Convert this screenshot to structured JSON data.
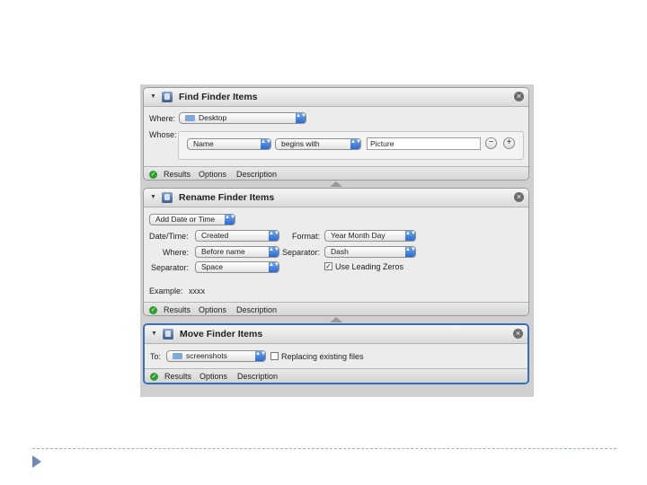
{
  "find": {
    "title": "Find Finder Items",
    "where_label": "Where:",
    "where_value": "Desktop",
    "whose_label": "Whose:",
    "attribute": "Name",
    "operator": "begins with",
    "value": "Picture",
    "remove_symbol": "−",
    "add_symbol": "+"
  },
  "rename": {
    "title": "Rename Finder Items",
    "mode": "Add Date or Time",
    "datetime_label": "Date/Time:",
    "datetime_value": "Created",
    "where_label": "Where:",
    "where_value": "Before name",
    "separator_label": "Separator:",
    "separator_value": "Space",
    "format_label": "Format:",
    "format_value": "Year Month Day",
    "separator2_label": "Separator:",
    "separator2_value": "Dash",
    "leading_zeros_label": "Use Leading Zeros",
    "leading_zeros_checked": true,
    "example_label": "Example:",
    "example_value": "xxxx"
  },
  "move": {
    "title": "Move Finder Items",
    "to_label": "To:",
    "to_value": "screenshots",
    "replace_label": "Replacing existing files",
    "replace_checked": false
  },
  "footer": {
    "results": "Results",
    "options": "Options",
    "description": "Description"
  },
  "icons": {
    "close": "×",
    "check": "✓",
    "disclosure": "▼",
    "popup_arrows": "▲▼"
  },
  "colors": {
    "selected_border": "#3a6fb8",
    "popup_arrow": "#2d6ad0",
    "status_ok": "#2f9e2f",
    "slide_rule": "#9bb0c8",
    "slide_bullet": "#6f8cb0"
  }
}
